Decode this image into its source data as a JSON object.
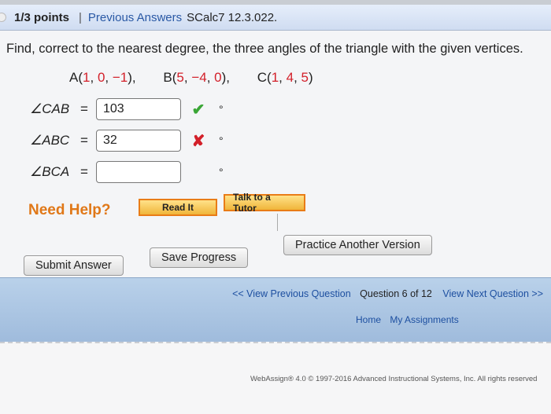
{
  "header": {
    "points": "1/3 points",
    "separator": "|",
    "previous_answers": "Previous Answers",
    "course_code": "SCalc7 12.3.022."
  },
  "problem": {
    "prompt": "Find, correct to the nearest degree, the three angles of the triangle with the given vertices.",
    "vertices": [
      {
        "name": "A",
        "coords": [
          "1",
          "0",
          "−1"
        ]
      },
      {
        "name": "B",
        "coords": [
          "5",
          "−4",
          "0"
        ]
      },
      {
        "name": "C",
        "coords": [
          "1",
          "4",
          "5"
        ]
      }
    ]
  },
  "answers": [
    {
      "label": "∠CAB",
      "eq": "=",
      "value": "103",
      "status": "correct",
      "unit": "°"
    },
    {
      "label": "∠ABC",
      "eq": "=",
      "value": "32",
      "status": "incorrect",
      "unit": "°"
    },
    {
      "label": "∠BCA",
      "eq": "=",
      "value": "",
      "status": "none",
      "unit": "°"
    }
  ],
  "help": {
    "label": "Need Help?",
    "read_it": "Read It",
    "talk_to_tutor": "Talk to a Tutor"
  },
  "actions": {
    "submit": "Submit Answer",
    "save": "Save Progress",
    "practice": "Practice Another Version"
  },
  "nav": {
    "view_previous": "<< View Previous Question",
    "question_of": "Question 6 of 12",
    "view_next": "View Next Question >>",
    "home": "Home",
    "my_assignments": "My Assignments"
  },
  "footer": {
    "copyright": "WebAssign® 4.0 © 1997-2016 Advanced Instructional Systems, Inc. All rights reserved"
  },
  "colors": {
    "header_bg": "#cfdcf1",
    "link": "#2a59a5",
    "correct": "#3aa636",
    "incorrect": "#d3202a",
    "help_orange": "#e07818",
    "nav_bg": "#9fbbdc"
  }
}
